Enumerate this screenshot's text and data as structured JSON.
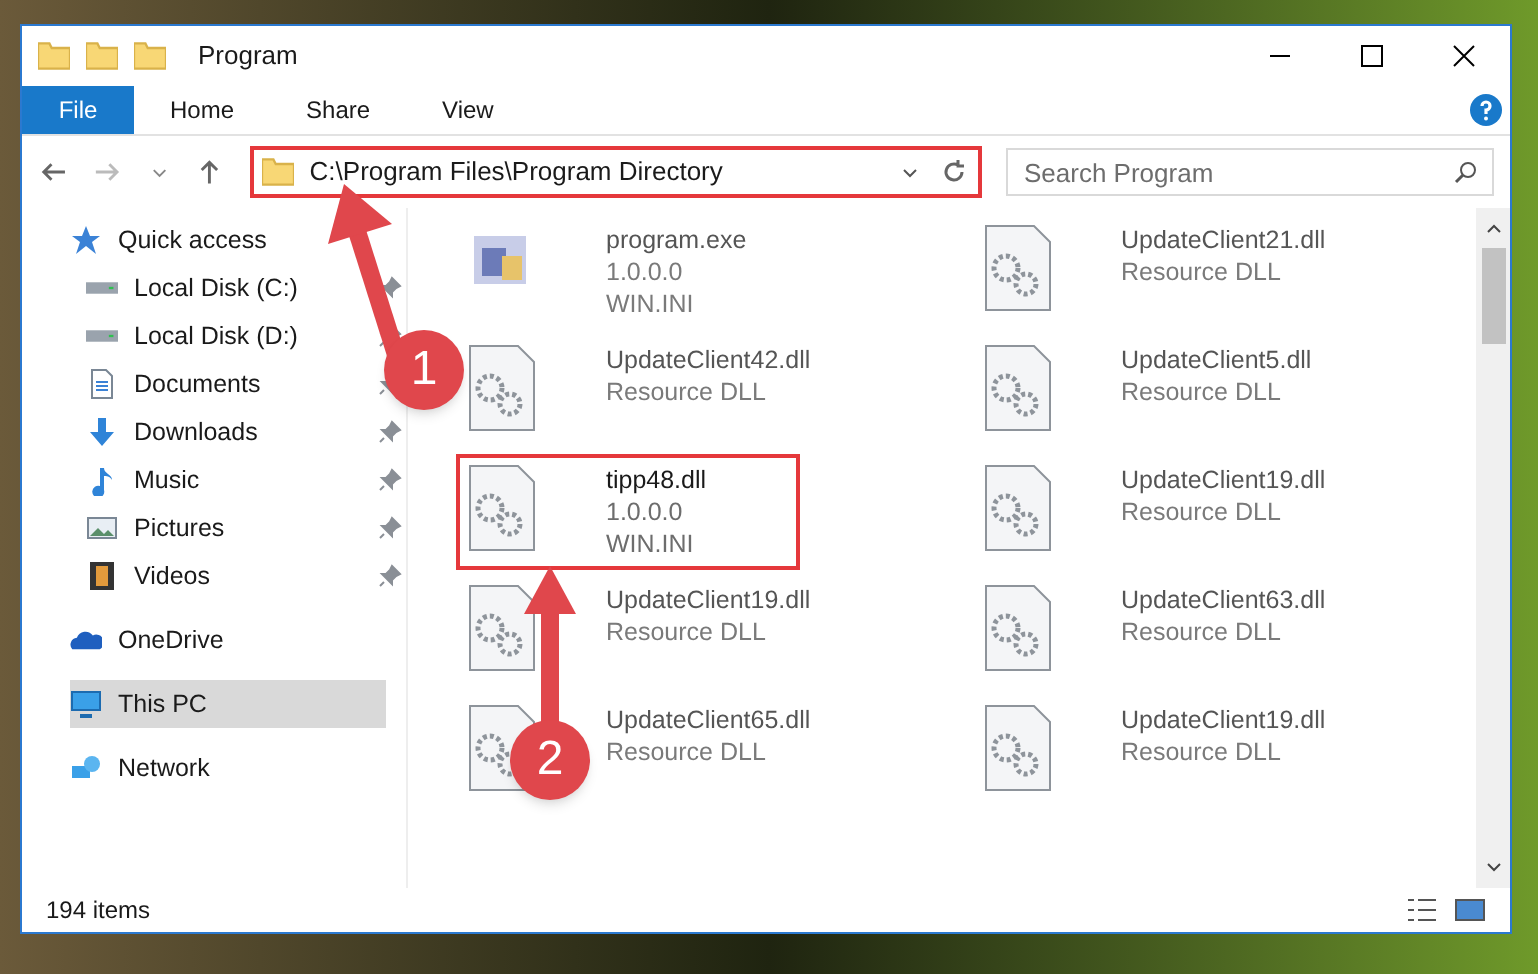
{
  "window": {
    "title": "Program"
  },
  "ribbon_tabs": [
    {
      "label": "File",
      "selected": true
    },
    {
      "label": "Home",
      "selected": false
    },
    {
      "label": "Share",
      "selected": false
    },
    {
      "label": "View",
      "selected": false
    }
  ],
  "address_bar": {
    "path": "C:\\Program Files\\Program Directory"
  },
  "search": {
    "placeholder": "Search Program"
  },
  "sidebar": {
    "items": [
      {
        "label": "Quick access",
        "selected": false,
        "children": [
          {
            "label": "Local Disk (C:)",
            "pinned": true,
            "selected": false
          },
          {
            "label": "Local Disk (D:)",
            "pinned": true,
            "selected": false
          },
          {
            "label": "Documents",
            "pinned": true,
            "selected": false
          },
          {
            "label": "Downloads",
            "pinned": true,
            "selected": false
          },
          {
            "label": "Music",
            "pinned": true,
            "selected": false
          },
          {
            "label": "Pictures",
            "pinned": true,
            "selected": false
          },
          {
            "label": "Videos",
            "pinned": true,
            "selected": false
          }
        ]
      },
      {
        "label": "OneDrive",
        "selected": false
      },
      {
        "label": "This PC",
        "selected": true
      },
      {
        "label": "Network",
        "selected": false
      }
    ]
  },
  "files": [
    {
      "name": "program.exe",
      "lines": [
        "1.0.0.0",
        "WIN.INI"
      ],
      "kind": "exe",
      "highlighted": false
    },
    {
      "name": "UpdateClient21.dll",
      "lines": [
        "Resource DLL"
      ],
      "kind": "dll",
      "highlighted": false
    },
    {
      "name": "UpdateClient42.dll",
      "lines": [
        "Resource DLL"
      ],
      "kind": "dll",
      "highlighted": false
    },
    {
      "name": "UpdateClient5.dll",
      "lines": [
        "Resource DLL"
      ],
      "kind": "dll",
      "highlighted": false
    },
    {
      "name": "tipp48.dll",
      "lines": [
        "1.0.0.0",
        "WIN.INI"
      ],
      "kind": "dll",
      "highlighted": true
    },
    {
      "name": "UpdateClient19.dll",
      "lines": [
        "Resource DLL"
      ],
      "kind": "dll",
      "highlighted": false
    },
    {
      "name": "UpdateClient19.dll",
      "lines": [
        "Resource DLL"
      ],
      "kind": "dll",
      "highlighted": false
    },
    {
      "name": "UpdateClient63.dll",
      "lines": [
        "Resource DLL"
      ],
      "kind": "dll",
      "highlighted": false
    },
    {
      "name": "UpdateClient65.dll",
      "lines": [
        "Resource DLL"
      ],
      "kind": "dll",
      "highlighted": false
    },
    {
      "name": "UpdateClient19.dll",
      "lines": [
        "Resource DLL"
      ],
      "kind": "dll",
      "highlighted": false
    }
  ],
  "status_bar": {
    "count": "194 items"
  },
  "annotations": [
    {
      "number": "1"
    },
    {
      "number": "2"
    }
  ]
}
